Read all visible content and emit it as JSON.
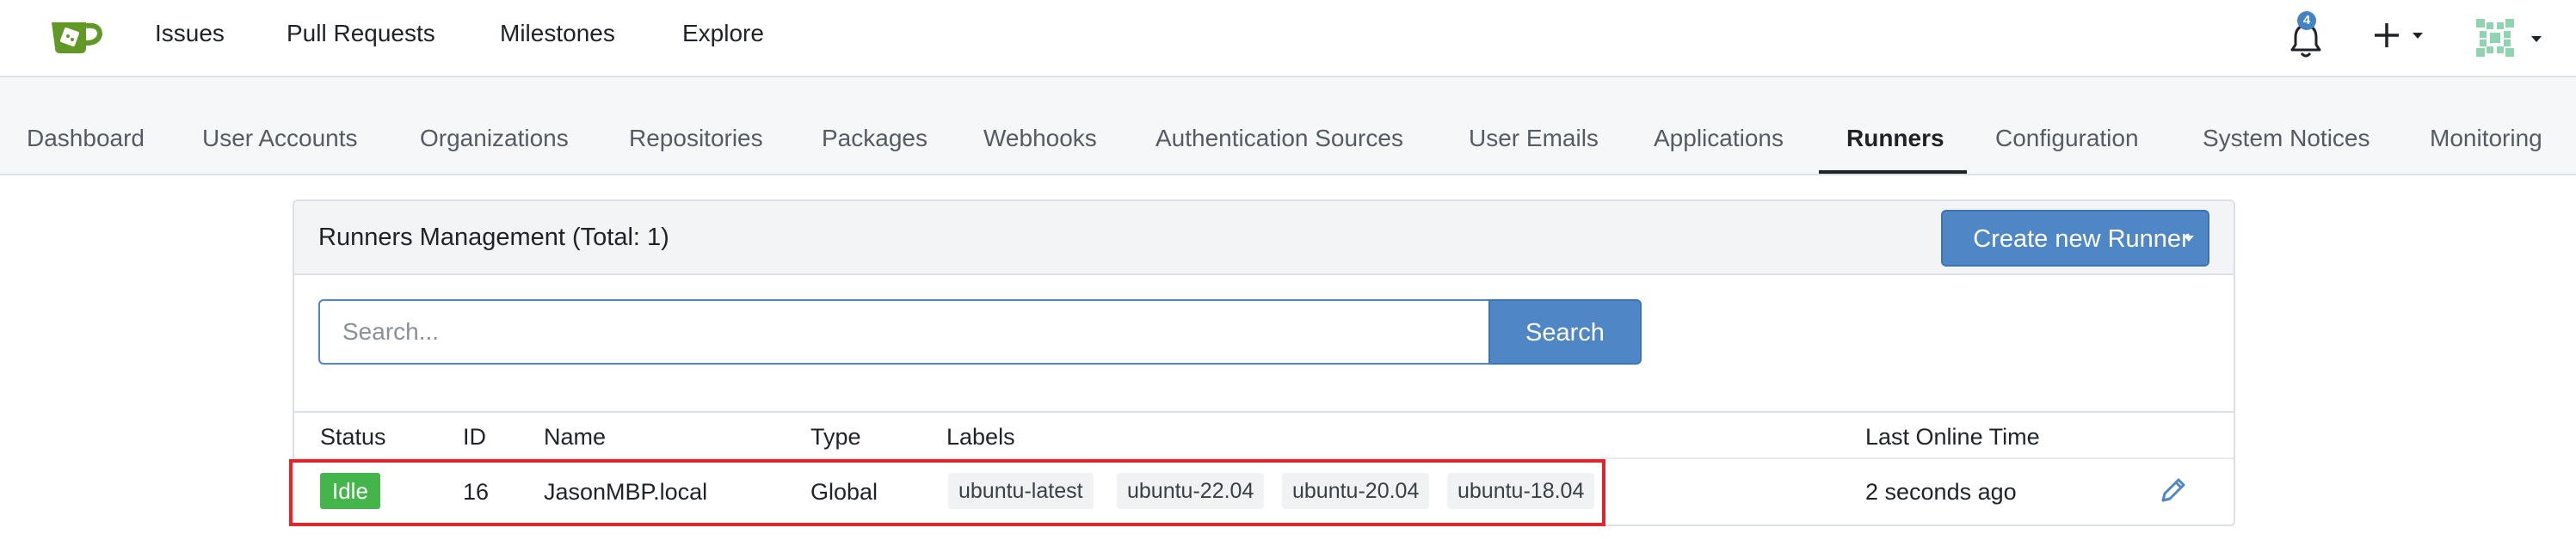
{
  "topnav": {
    "items": [
      {
        "label": "Issues"
      },
      {
        "label": "Pull Requests"
      },
      {
        "label": "Milestones"
      },
      {
        "label": "Explore"
      }
    ],
    "notification_count": "4",
    "logo_icon": "gitea-logo-icon",
    "notification_icon": "bell-icon",
    "create_icon": "plus-icon",
    "avatar_icon": "avatar-identicon"
  },
  "admin_tabs": [
    {
      "label": "Dashboard"
    },
    {
      "label": "User Accounts"
    },
    {
      "label": "Organizations"
    },
    {
      "label": "Repositories"
    },
    {
      "label": "Packages"
    },
    {
      "label": "Webhooks"
    },
    {
      "label": "Authentication Sources"
    },
    {
      "label": "User Emails"
    },
    {
      "label": "Applications"
    },
    {
      "label": "Runners"
    },
    {
      "label": "Configuration"
    },
    {
      "label": "System Notices"
    },
    {
      "label": "Monitoring"
    }
  ],
  "active_tab": "Runners",
  "runners": {
    "title": "Runners Management (Total: 1)",
    "create_button": "Create new Runner",
    "search": {
      "placeholder": "Search...",
      "value": "",
      "button": "Search"
    },
    "columns": [
      "Status",
      "ID",
      "Name",
      "Type",
      "Labels",
      "Last Online Time"
    ],
    "rows": [
      {
        "status": "Idle",
        "id": "16",
        "name": "JasonMBP.local",
        "type": "Global",
        "labels": [
          "ubuntu-latest",
          "ubuntu-22.04",
          "ubuntu-20.04",
          "ubuntu-18.04"
        ],
        "last_online": "2 seconds ago"
      }
    ]
  },
  "colors": {
    "accent": "#4f86c6",
    "status_idle": "#44b54b",
    "highlight": "#e0262b",
    "notification_badge": "#4183c4",
    "logo_green": "#609926"
  }
}
